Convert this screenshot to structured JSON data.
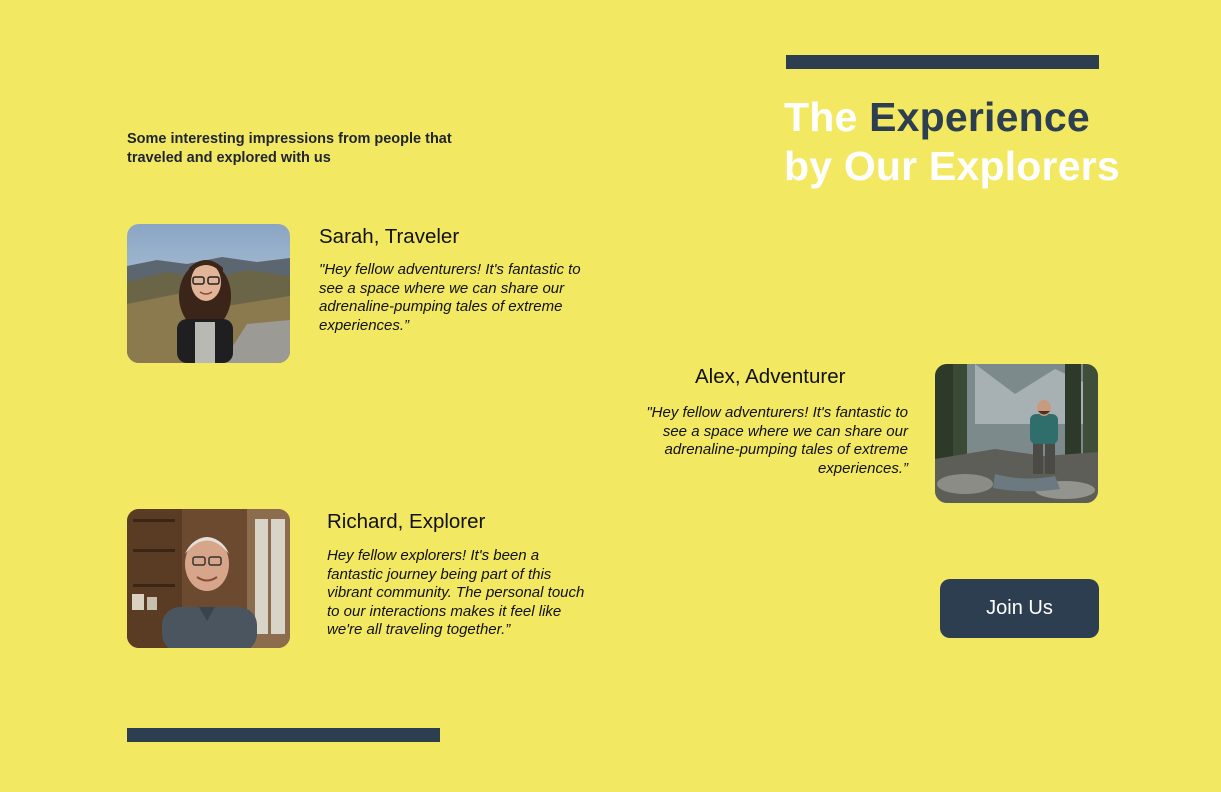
{
  "header": {
    "title_prefix": "The ",
    "title_highlight": "Experience",
    "title_suffix": "by Our Explorers",
    "intro": "Some interesting impressions from people that traveled and explored with us"
  },
  "testimonials": [
    {
      "name": "Sarah, Traveler",
      "quote": "\"Hey fellow adventurers! It's fantastic to see a space where we can share our adrenaline-pumping tales of extreme experiences.”"
    },
    {
      "name": "Alex, Adventurer",
      "quote": "\"Hey fellow adventurers! It's fantastic to see a space where we can share our adrenaline-pumping tales of extreme experiences.”"
    },
    {
      "name": "Richard, Explorer",
      "quote": "Hey fellow explorers! It's been a fantastic journey being part of this vibrant community. The personal touch to our interactions makes it feel like we're all traveling together.”"
    }
  ],
  "cta": {
    "label": "Join Us"
  },
  "colors": {
    "background": "#F2E862",
    "accent_dark": "#2C3E50",
    "heading_light": "#FFFFFF"
  }
}
